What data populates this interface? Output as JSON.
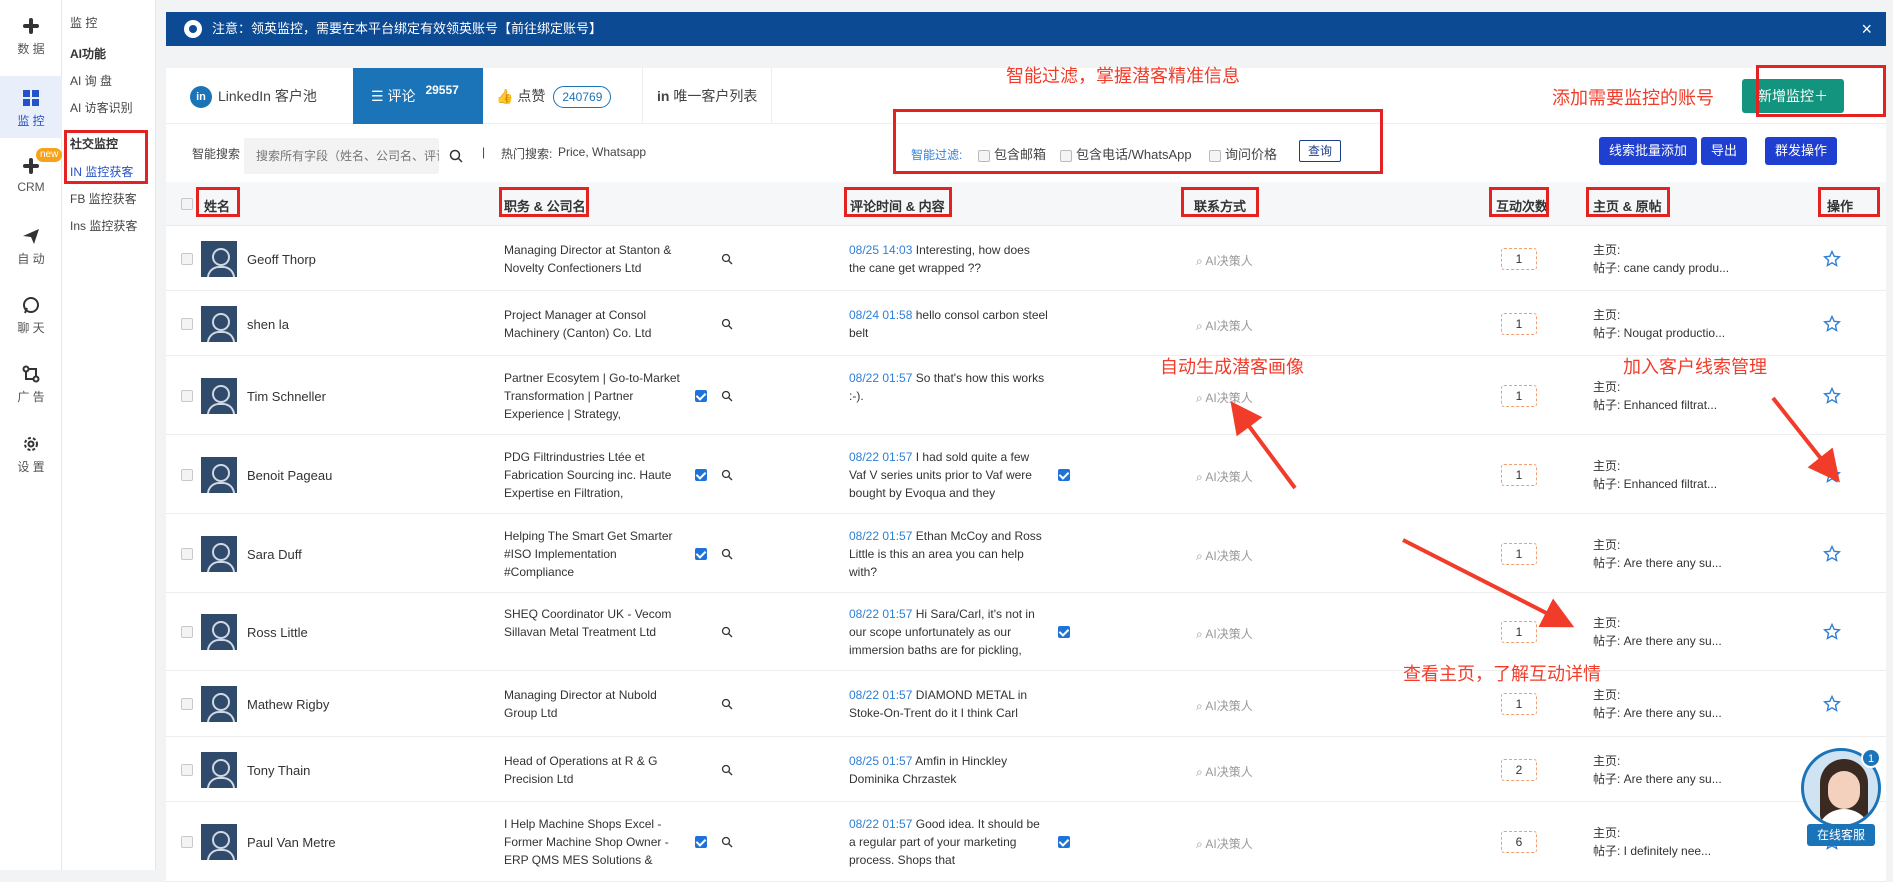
{
  "notice": {
    "text": "注意：领英监控，需要在本平台绑定有效领英账号【前往绑定账号】",
    "close": "×"
  },
  "rail": {
    "items": [
      {
        "label": "数 据",
        "icon": "slack-icon"
      },
      {
        "label": "监 控",
        "icon": "grid-icon"
      },
      {
        "label": "CRM",
        "icon": "slack-icon",
        "badge": "new"
      },
      {
        "label": "自 动",
        "icon": "send-icon"
      },
      {
        "label": "聊 天",
        "icon": "whatsapp-icon"
      },
      {
        "label": "广 告",
        "icon": "branch-icon"
      },
      {
        "label": "设 置",
        "icon": "gear-icon"
      }
    ]
  },
  "submenu": {
    "items": [
      "监 控",
      "AI功能",
      "AI 询 盘",
      "AI 访客识别",
      "社交监控",
      "IN 监控获客",
      "FB 监控获客",
      "Ins 监控获客"
    ]
  },
  "tabs": {
    "linkedin": "LinkedIn 客户池",
    "comments": "评论",
    "comments_count": "29557",
    "likes": "点赞",
    "likes_count": "240769",
    "unique": "唯一客户列表"
  },
  "actions": {
    "new_monitor": "新增监控＋",
    "batch_add": "线索批量添加",
    "export": "导出",
    "group_ops": "群发操作"
  },
  "search": {
    "label": "智能搜索",
    "placeholder": "搜索所有字段（姓名、公司名、评论",
    "hot_label": "热门搜索:",
    "hot_terms": "Price, Whatsapp"
  },
  "filter": {
    "label": "智能过滤:",
    "options": [
      "包含邮箱",
      "包含电话/WhatsApp",
      "询问价格"
    ],
    "query": "查询"
  },
  "annotations": {
    "filter": "智能过滤，掌握潜客精准信息",
    "add_account": "添加需要监控的账号",
    "portrait": "自动生成潜客画像",
    "crm": "加入客户线索管理",
    "homepage": "查看主页，了解互动详情"
  },
  "table": {
    "columns": [
      "姓名",
      "职务 & 公司名",
      "评论时间 & 内容",
      "联系方式",
      "互动次数",
      "主页 & 原帖",
      "操作"
    ],
    "contact_text": "AI决策人",
    "home_label": "主页:",
    "rows": [
      {
        "name": "Geoff Thorp",
        "job": "Managing Director at Stanton & Novelty Confectioners Ltd",
        "job_check": false,
        "time": "08/25 14:03",
        "comment": "Interesting, how does the cane get wrapped ??",
        "comment_check": false,
        "count": "1",
        "post": "帖子: cane candy produ..."
      },
      {
        "name": "shen la",
        "job": "Project Manager at Consol Machinery (Canton) Co. Ltd",
        "job_check": false,
        "time": "08/24 01:58",
        "comment": "hello consol carbon steel belt",
        "comment_check": false,
        "count": "1",
        "post": "帖子: Nougat productio..."
      },
      {
        "name": "Tim Schneller",
        "job": "Partner Ecosytem | Go-to-Market Transformation | Partner Experience | Strategy,",
        "job_check": true,
        "time": "08/22 01:57",
        "comment": "So that's how this works :-).",
        "comment_check": false,
        "count": "1",
        "post": "帖子: Enhanced filtrat..."
      },
      {
        "name": "Benoit Pageau",
        "job": "PDG Filtrindustries Ltée et Fabrication Sourcing inc. Haute Expertise en Filtration,",
        "job_check": true,
        "time": "08/22 01:57",
        "comment": "I had sold quite a few Vaf V series units prior to Vaf were bought by Evoqua and they",
        "comment_check": true,
        "count": "1",
        "post": "帖子: Enhanced filtrat..."
      },
      {
        "name": "Sara Duff",
        "job": "Helping The Smart Get Smarter #ISO Implementation #Compliance",
        "job_check": true,
        "time": "08/22 01:57",
        "comment": "Ethan McCoy and Ross Little is this an area you can help with?",
        "comment_check": false,
        "count": "1",
        "post": "帖子: Are there any su..."
      },
      {
        "name": "Ross Little",
        "job": "SHEQ Coordinator UK - Vecom Sillavan Metal Treatment Ltd",
        "job_check": false,
        "time": "08/22 01:57",
        "comment": "Hi Sara/Carl, it's not in our scope unfortunately as our immersion baths are for pickling,",
        "comment_check": true,
        "count": "1",
        "post": "帖子: Are there any su..."
      },
      {
        "name": "Mathew Rigby",
        "job": "Managing Director at Nubold Group Ltd",
        "job_check": false,
        "time": "08/22 01:57",
        "comment": "DIAMOND METAL in Stoke-On-Trent do it I think Carl",
        "comment_check": false,
        "count": "1",
        "post": "帖子: Are there any su..."
      },
      {
        "name": "Tony Thain",
        "job": "Head of Operations at R & G Precision Ltd",
        "job_check": false,
        "time": "08/25 01:57",
        "comment": "Amfin in Hinckley Dominika Chrzastek",
        "comment_check": false,
        "count": "2",
        "post": "帖子: Are there any su..."
      },
      {
        "name": "Paul Van Metre",
        "job": "I Help Machine Shops Excel - Former Machine Shop Owner - ERP QMS MES Solutions &",
        "job_check": true,
        "time": "08/22 01:57",
        "comment": "Good idea. It should be a regular part of your marketing process. Shops that",
        "comment_check": true,
        "count": "6",
        "post": "帖子: I definitely nee..."
      }
    ]
  },
  "support": {
    "label": "在线客服",
    "badge": "1"
  }
}
